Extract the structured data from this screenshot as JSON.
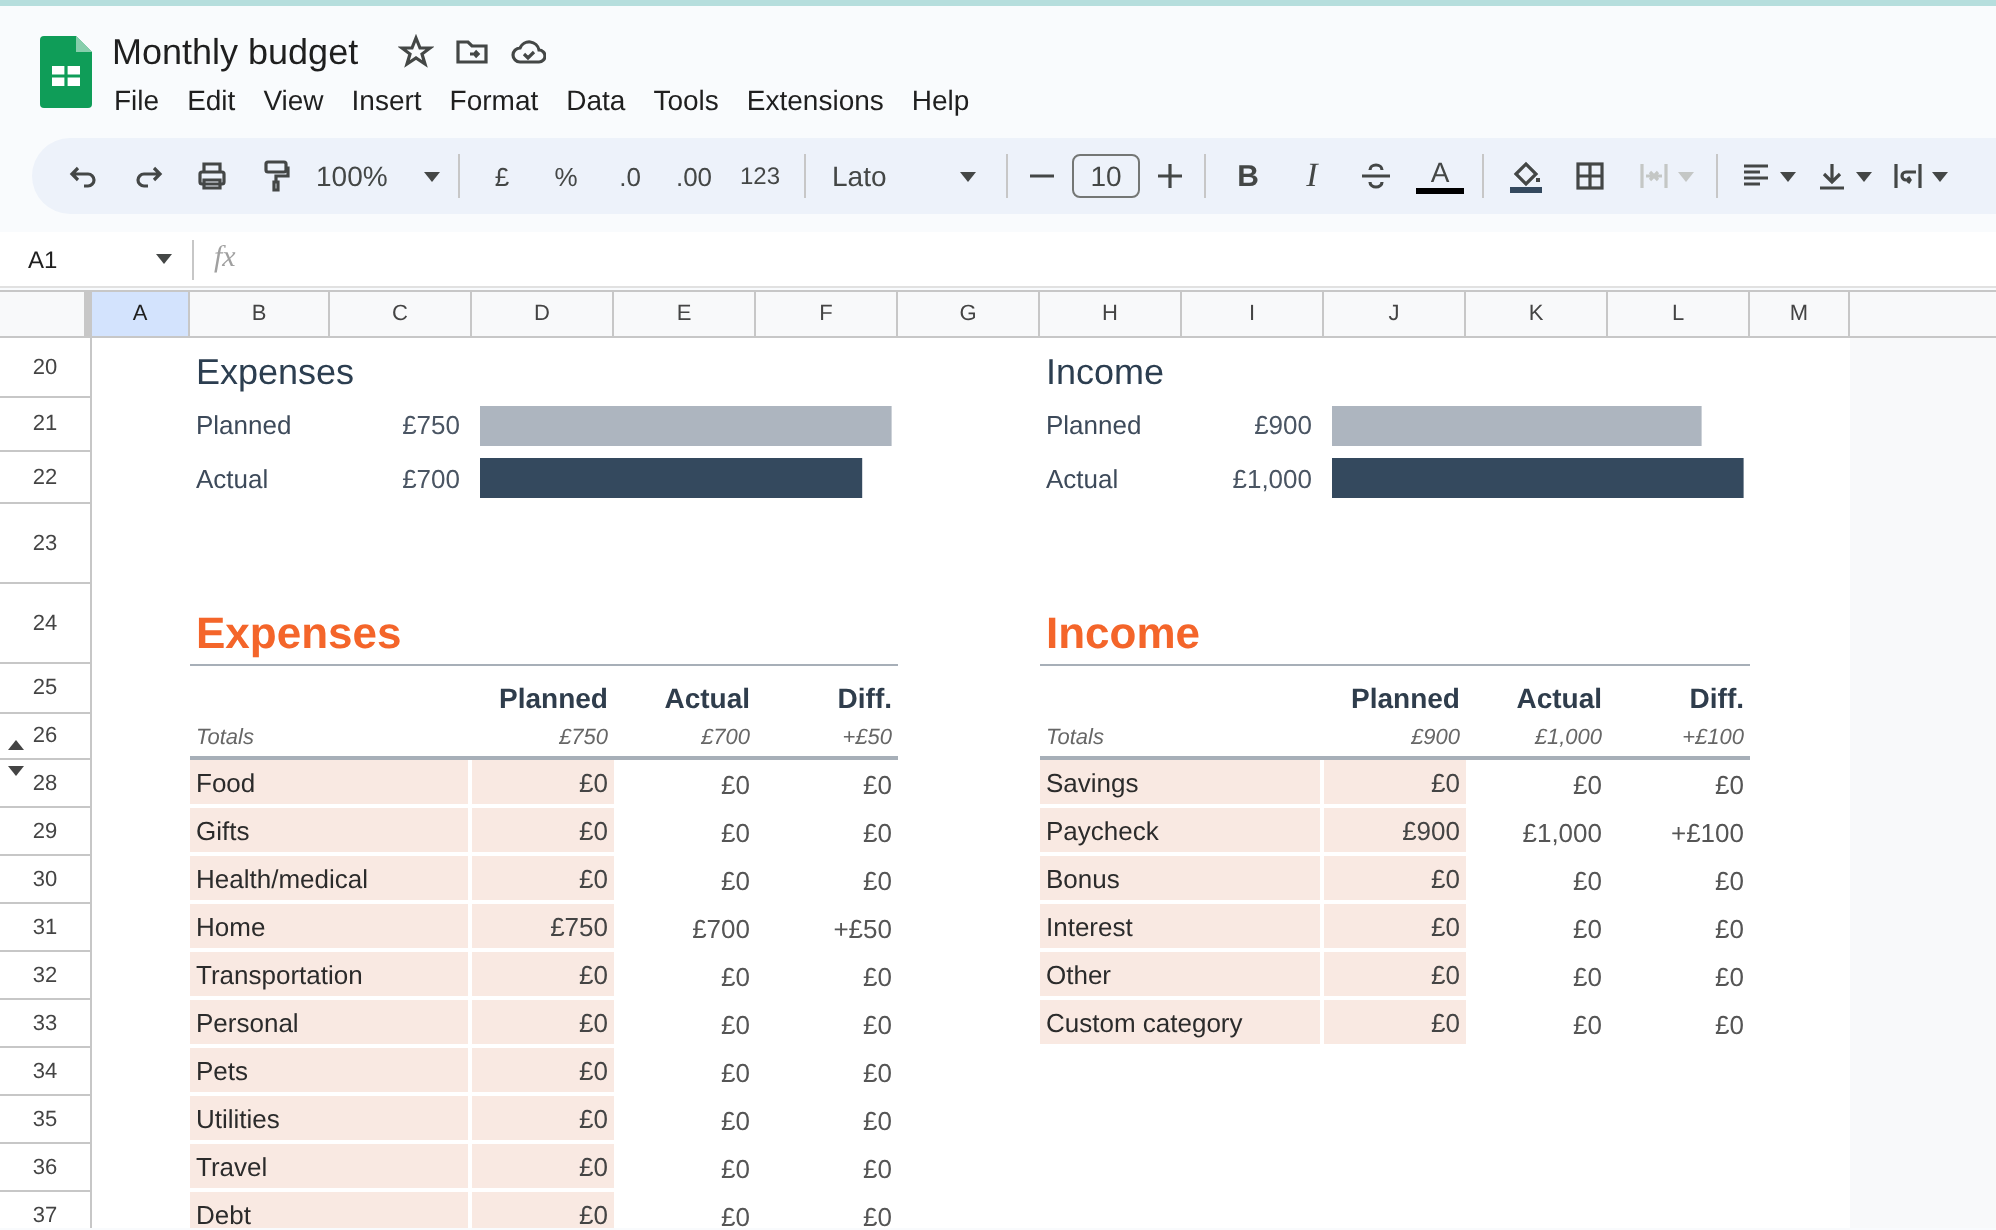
{
  "app": {
    "title": "Monthly budget",
    "menu": [
      "File",
      "Edit",
      "View",
      "Insert",
      "Format",
      "Data",
      "Tools",
      "Extensions",
      "Help"
    ]
  },
  "toolbar": {
    "zoom": "100%",
    "formats": [
      "£",
      "%",
      ".0",
      ".00",
      "123"
    ],
    "font": "Lato",
    "font_size": "10",
    "bold": "B",
    "italic": "I",
    "text_color": "A",
    "merge": {
      "disabled": true
    }
  },
  "formula_bar": {
    "cell": "A1",
    "fx": "fx"
  },
  "columns": [
    {
      "label": "A",
      "selected": true
    },
    {
      "label": "B",
      "selected": false
    },
    {
      "label": "C",
      "selected": false
    },
    {
      "label": "D",
      "selected": false
    },
    {
      "label": "E",
      "selected": false
    },
    {
      "label": "F",
      "selected": false
    },
    {
      "label": "G",
      "selected": false
    },
    {
      "label": "H",
      "selected": false
    },
    {
      "label": "I",
      "selected": false
    },
    {
      "label": "J",
      "selected": false
    },
    {
      "label": "K",
      "selected": false
    },
    {
      "label": "L",
      "selected": false
    },
    {
      "label": "M",
      "selected": false
    }
  ],
  "rows": [
    {
      "label": "20",
      "kind": "plain"
    },
    {
      "label": "21",
      "kind": "plain"
    },
    {
      "label": "22",
      "kind": "plain"
    },
    {
      "label": "23",
      "kind": "plain"
    },
    {
      "label": "24",
      "kind": "plain"
    },
    {
      "label": "25",
      "kind": "plain"
    },
    {
      "label": "26",
      "kind": "collapse"
    },
    {
      "label": "28",
      "kind": "expand"
    },
    {
      "label": "29",
      "kind": "plain"
    },
    {
      "label": "30",
      "kind": "plain"
    },
    {
      "label": "31",
      "kind": "plain"
    },
    {
      "label": "32",
      "kind": "plain"
    },
    {
      "label": "33",
      "kind": "plain"
    },
    {
      "label": "34",
      "kind": "plain"
    },
    {
      "label": "35",
      "kind": "plain"
    },
    {
      "label": "36",
      "kind": "plain"
    },
    {
      "label": "37",
      "kind": "plain"
    }
  ],
  "sections": [
    {
      "summary": {
        "title": "Expenses",
        "bars": [
          {
            "kind": "planned",
            "label": "Planned",
            "amount": "£750",
            "level": 0.98
          },
          {
            "kind": "actual",
            "label": "Actual",
            "amount": "£700",
            "level": 0.91
          }
        ]
      },
      "heading": "Expenses",
      "columns": [
        "Planned",
        "Actual",
        "Diff."
      ],
      "totals": {
        "label": "Totals",
        "values": [
          "£750",
          "£700",
          "+£50"
        ]
      },
      "rows": [
        {
          "category": "Food",
          "planned": "£0",
          "actual": "£0",
          "diff": "£0"
        },
        {
          "category": "Gifts",
          "planned": "£0",
          "actual": "£0",
          "diff": "£0"
        },
        {
          "category": "Health/medical",
          "planned": "£0",
          "actual": "£0",
          "diff": "£0"
        },
        {
          "category": "Home",
          "planned": "£750",
          "actual": "£700",
          "diff": "+£50"
        },
        {
          "category": "Transportation",
          "planned": "£0",
          "actual": "£0",
          "diff": "£0"
        },
        {
          "category": "Personal",
          "planned": "£0",
          "actual": "£0",
          "diff": "£0"
        },
        {
          "category": "Pets",
          "planned": "£0",
          "actual": "£0",
          "diff": "£0"
        },
        {
          "category": "Utilities",
          "planned": "£0",
          "actual": "£0",
          "diff": "£0"
        },
        {
          "category": "Travel",
          "planned": "£0",
          "actual": "£0",
          "diff": "£0"
        },
        {
          "category": "Debt",
          "planned": "£0",
          "actual": "£0",
          "diff": "£0"
        }
      ]
    },
    {
      "summary": {
        "title": "Income",
        "bars": [
          {
            "kind": "planned",
            "label": "Planned",
            "amount": "£900",
            "level": 0.88
          },
          {
            "kind": "actual",
            "label": "Actual",
            "amount": "£1,000",
            "level": 0.98
          }
        ]
      },
      "heading": "Income",
      "columns": [
        "Planned",
        "Actual",
        "Diff."
      ],
      "totals": {
        "label": "Totals",
        "values": [
          "£900",
          "£1,000",
          "+£100"
        ]
      },
      "rows": [
        {
          "category": "Savings",
          "planned": "£0",
          "actual": "£0",
          "diff": "£0"
        },
        {
          "category": "Paycheck",
          "planned": "£900",
          "actual": "£1,000",
          "diff": "+£100"
        },
        {
          "category": "Bonus",
          "planned": "£0",
          "actual": "£0",
          "diff": "£0"
        },
        {
          "category": "Interest",
          "planned": "£0",
          "actual": "£0",
          "diff": "£0"
        },
        {
          "category": "Other",
          "planned": "£0",
          "actual": "£0",
          "diff": "£0"
        },
        {
          "category": "Custom category",
          "planned": "£0",
          "actual": "£0",
          "diff": "£0"
        }
      ]
    }
  ]
}
